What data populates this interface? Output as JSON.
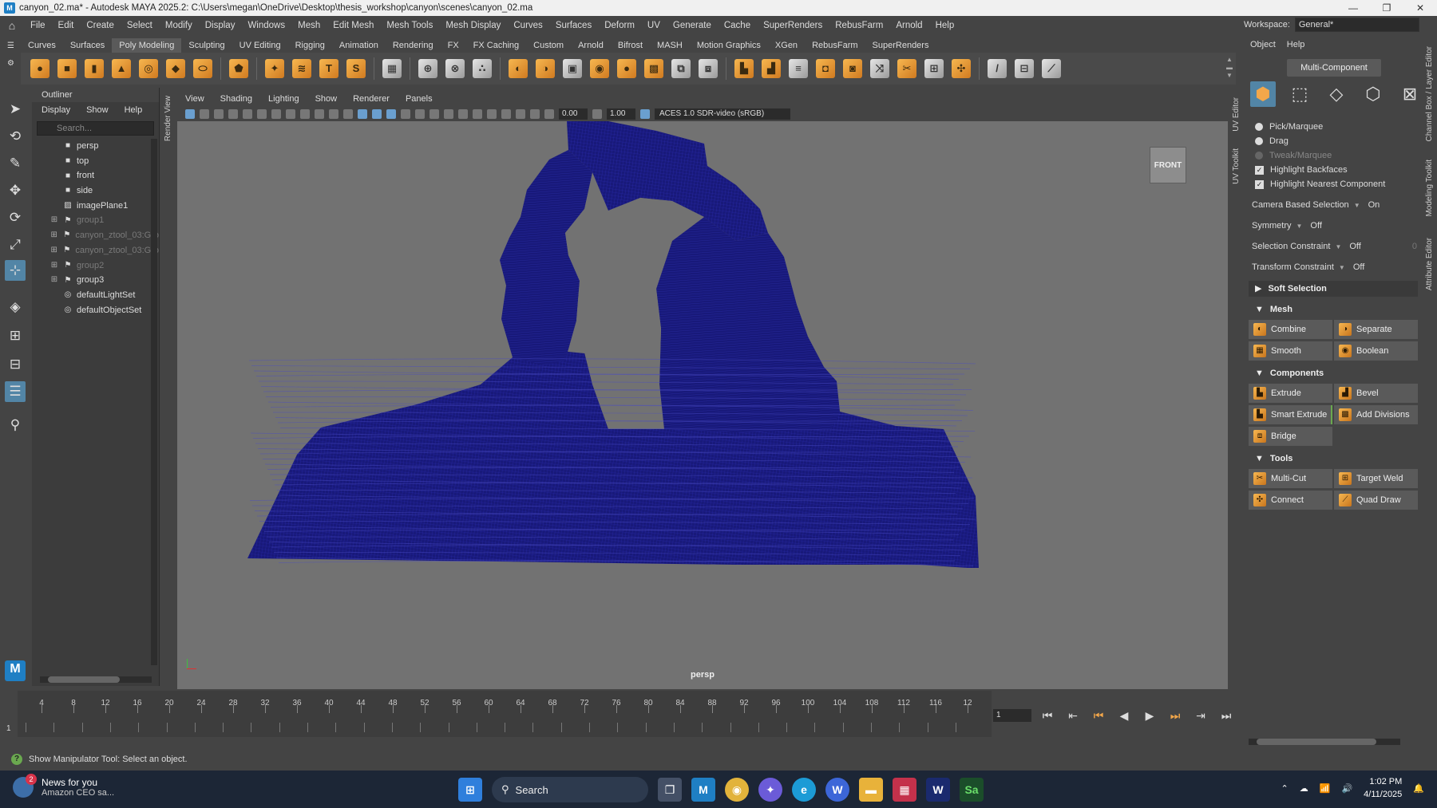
{
  "window": {
    "title": "canyon_02.ma* - Autodesk MAYA 2025.2: C:\\Users\\megan\\OneDrive\\Desktop\\thesis_workshop\\canyon\\scenes\\canyon_02.ma",
    "controls": [
      "—",
      "❐",
      "✕"
    ]
  },
  "menubar": {
    "items": [
      "File",
      "Edit",
      "Create",
      "Select",
      "Modify",
      "Display",
      "Windows",
      "Mesh",
      "Edit Mesh",
      "Mesh Tools",
      "Mesh Display",
      "Curves",
      "Surfaces",
      "Deform",
      "UV",
      "Generate",
      "Cache",
      "SuperRenders",
      "RebusFarm",
      "Arnold",
      "Help"
    ],
    "workspace_label": "Workspace:",
    "workspace_value": "General*"
  },
  "shelf": {
    "tabs": [
      "Curves",
      "Surfaces",
      "Poly Modeling",
      "Sculpting",
      "UV Editing",
      "Rigging",
      "Animation",
      "Rendering",
      "FX",
      "FX Caching",
      "Custom",
      "Arnold",
      "Bifrost",
      "MASH",
      "Motion Graphics",
      "XGen",
      "RebusFarm",
      "SuperRenders"
    ],
    "active_tab": "Poly Modeling"
  },
  "outliner": {
    "title": "Outliner",
    "menu": [
      "Display",
      "Show",
      "Help"
    ],
    "search_placeholder": "Search...",
    "items": [
      {
        "label": "persp",
        "icon": "camera-icon",
        "expandable": false,
        "dim": false
      },
      {
        "label": "top",
        "icon": "camera-icon",
        "expandable": false,
        "dim": false
      },
      {
        "label": "front",
        "icon": "camera-icon",
        "expandable": false,
        "dim": false
      },
      {
        "label": "side",
        "icon": "camera-icon",
        "expandable": false,
        "dim": false
      },
      {
        "label": "imagePlane1",
        "icon": "image-plane-icon",
        "expandable": false,
        "dim": false
      },
      {
        "label": "group1",
        "icon": "group-icon",
        "expandable": true,
        "dim": true
      },
      {
        "label": "canyon_ztool_03:Gro",
        "icon": "group-icon",
        "expandable": true,
        "dim": true
      },
      {
        "label": "canyon_ztool_03:Gro",
        "icon": "group-icon",
        "expandable": true,
        "dim": true
      },
      {
        "label": "group2",
        "icon": "group-icon",
        "expandable": true,
        "dim": true
      },
      {
        "label": "group3",
        "icon": "group-icon",
        "expandable": true,
        "dim": false
      },
      {
        "label": "defaultLightSet",
        "icon": "set-icon",
        "expandable": false,
        "dim": false
      },
      {
        "label": "defaultObjectSet",
        "icon": "set-icon",
        "expandable": false,
        "dim": false
      }
    ]
  },
  "side_tabs": {
    "render_view": "Render View",
    "uv_editor": "UV Editor",
    "uv_toolkit": "UV Toolkit",
    "channel_box": "Channel Box / Layer Editor",
    "modeling_toolkit": "Modeling Toolkit",
    "attribute_editor": "Attribute Editor"
  },
  "viewport": {
    "menu": [
      "View",
      "Shading",
      "Lighting",
      "Show",
      "Renderer",
      "Panels"
    ],
    "exposure": "0.00",
    "gamma": "1.00",
    "color_space": "ACES 1.0 SDR-video (sRGB)",
    "viewcube_label": "FRONT",
    "camera_label": "persp",
    "wire_color": "#18197a"
  },
  "modeling_toolkit": {
    "menu": [
      "Object",
      "Help"
    ],
    "multi_component": "Multi-Component",
    "selection_modes": [
      {
        "name": "object-mode-icon",
        "glyph": "⬢",
        "active": true
      },
      {
        "name": "vertex-mode-icon",
        "glyph": "⬚",
        "active": false
      },
      {
        "name": "edge-mode-icon",
        "glyph": "◇",
        "active": false
      },
      {
        "name": "face-mode-icon",
        "glyph": "⬡",
        "active": false
      },
      {
        "name": "uv-mode-icon",
        "glyph": "⊠",
        "active": false
      }
    ],
    "radios": [
      {
        "label": "Pick/Marquee",
        "dim": false
      },
      {
        "label": "Drag",
        "dim": false
      },
      {
        "label": "Tweak/Marquee",
        "dim": true
      }
    ],
    "checks": [
      "Highlight Backfaces",
      "Highlight Nearest Component"
    ],
    "props": [
      {
        "label": "Camera Based Selection",
        "value": "On",
        "extra": ""
      },
      {
        "label": "Symmetry",
        "value": "Off",
        "extra": ""
      },
      {
        "label": "Selection Constraint",
        "value": "Off",
        "extra": "0"
      },
      {
        "label": "Transform Constraint",
        "value": "Off",
        "extra": ""
      }
    ],
    "sections": {
      "soft_selection": "Soft Selection",
      "mesh": "Mesh",
      "components": "Components",
      "tools": "Tools"
    },
    "mesh_buttons": [
      "Combine",
      "Separate",
      "Smooth",
      "Boolean"
    ],
    "component_buttons": [
      "Extrude",
      "Bevel",
      "Smart Extrude",
      "Add Divisions",
      "Bridge"
    ],
    "tool_buttons": [
      "Multi-Cut",
      "Target Weld",
      "Connect",
      "Quad Draw"
    ]
  },
  "timeline": {
    "labels": [
      "4",
      "8",
      "12",
      "16",
      "20",
      "24",
      "28",
      "32",
      "36",
      "40",
      "44",
      "48",
      "52",
      "56",
      "60",
      "64",
      "68",
      "72",
      "76",
      "80",
      "84",
      "88",
      "92",
      "96",
      "100",
      "104",
      "108",
      "112",
      "116",
      "12"
    ],
    "current_frame_marker": "1",
    "frame_input": "1",
    "playback": [
      "⏮",
      "⇤",
      "⏭",
      "◀",
      "▶",
      "⏩",
      "⏭",
      "⏭"
    ]
  },
  "helpline": {
    "text": "Show Manipulator Tool: Select an object."
  },
  "taskbar": {
    "news_badge": "2",
    "news_title": "News for you",
    "news_sub": "Amazon CEO sa...",
    "search_label": "Search",
    "time": "1:02 PM",
    "date": "4/11/2025",
    "apps": [
      "windows-start-icon",
      "task-view-icon",
      "maya-icon",
      "chrome-icon",
      "copilot-icon",
      "edge-icon",
      "w-app-icon",
      "file-explorer-icon",
      "app-icon",
      "dreamweaver-icon",
      "substance-icon"
    ]
  }
}
